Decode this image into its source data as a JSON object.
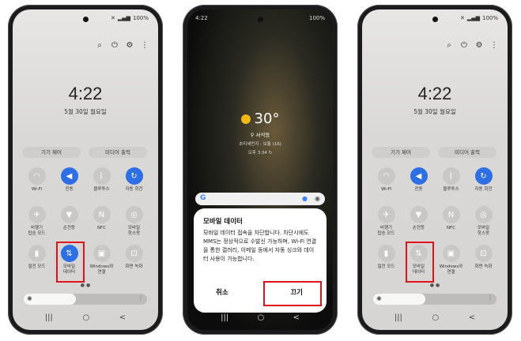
{
  "qs_panel": {
    "time": "4:22",
    "date": "5월 30일 월요일",
    "status_battery": "100%",
    "device_control_label": "기기 제어",
    "media_output_label": "미디어 출력",
    "tiles": [
      {
        "label": "Wi-Fi",
        "icon": "wifi-icon",
        "glyph": "◠",
        "on": false
      },
      {
        "label": "진동",
        "icon": "vibrate-icon",
        "glyph": "◀",
        "on": true
      },
      {
        "label": "블루투스",
        "icon": "bluetooth-icon",
        "glyph": "ᛒ",
        "on": false
      },
      {
        "label": "자동 회전",
        "icon": "rotate-icon",
        "glyph": "↻",
        "on": true
      },
      {
        "label": "비행기\n탑승 모드",
        "icon": "airplane-icon",
        "glyph": "✈",
        "on": false
      },
      {
        "label": "손전등",
        "icon": "flashlight-icon",
        "glyph": "▼",
        "on": false
      },
      {
        "label": "NFC",
        "icon": "nfc-icon",
        "glyph": "N",
        "on": false
      },
      {
        "label": "모바일\n핫스팟",
        "icon": "hotspot-icon",
        "glyph": "◎",
        "on": false
      },
      {
        "label": "절전 모드",
        "icon": "battery-icon",
        "glyph": "▮",
        "on": false
      },
      {
        "label": "모바일\n데이터",
        "icon": "mobile-data-icon",
        "glyph": "⇅",
        "on": true
      },
      {
        "label": "Windows와\n연결",
        "icon": "windows-link-icon",
        "glyph": "▣",
        "on": false
      },
      {
        "label": "화면 녹화",
        "icon": "screen-record-icon",
        "glyph": "⊡",
        "on": false
      }
    ],
    "tiles_after": [
      {
        "label": "Wi-Fi",
        "icon": "wifi-icon",
        "glyph": "◠",
        "on": false
      },
      {
        "label": "진동",
        "icon": "vibrate-icon",
        "glyph": "◀",
        "on": true
      },
      {
        "label": "블루투스",
        "icon": "bluetooth-icon",
        "glyph": "ᛒ",
        "on": false
      },
      {
        "label": "자동 회전",
        "icon": "rotate-icon",
        "glyph": "↻",
        "on": true
      },
      {
        "label": "비행기\n탑승 모드",
        "icon": "airplane-icon",
        "glyph": "✈",
        "on": false
      },
      {
        "label": "손전등",
        "icon": "flashlight-icon",
        "glyph": "▼",
        "on": false
      },
      {
        "label": "NFC",
        "icon": "nfc-icon",
        "glyph": "N",
        "on": false
      },
      {
        "label": "모바일\n핫스팟",
        "icon": "hotspot-icon",
        "glyph": "◎",
        "on": false
      },
      {
        "label": "절전 모드",
        "icon": "battery-icon",
        "glyph": "▮",
        "on": false
      },
      {
        "label": "모바일\n데이터",
        "icon": "mobile-data-icon",
        "glyph": "⇅",
        "on": false
      },
      {
        "label": "Windows와\n연결",
        "icon": "windows-link-icon",
        "glyph": "▣",
        "on": false
      },
      {
        "label": "화면 녹화",
        "icon": "screen-record-icon",
        "glyph": "⊡",
        "on": false
      }
    ]
  },
  "lock_screen": {
    "status_time": "4:22",
    "status_battery": "100%",
    "temperature": "30°",
    "location": "서석동",
    "air_quality": "초미세먼지 : 보통 (16)",
    "updated": "오후 3:34"
  },
  "dialog": {
    "title": "모바일 데이터",
    "message": "모바일 데이터 접속을 차단합니다. 차단시에도 MMS는 정상적으로 수발신 가능하며, Wi-Fi 연결을 통한 갤러리, 이메일 등에서 자동 싱크와 데이터 사용이 가능합니다.",
    "cancel_label": "취소",
    "confirm_label": "끄기"
  },
  "nav": {
    "recents": "|||",
    "home": "○",
    "back": "<"
  },
  "colors": {
    "accent": "#2f6fe4",
    "highlight": "#e0121b",
    "sun": "#f3b816"
  }
}
